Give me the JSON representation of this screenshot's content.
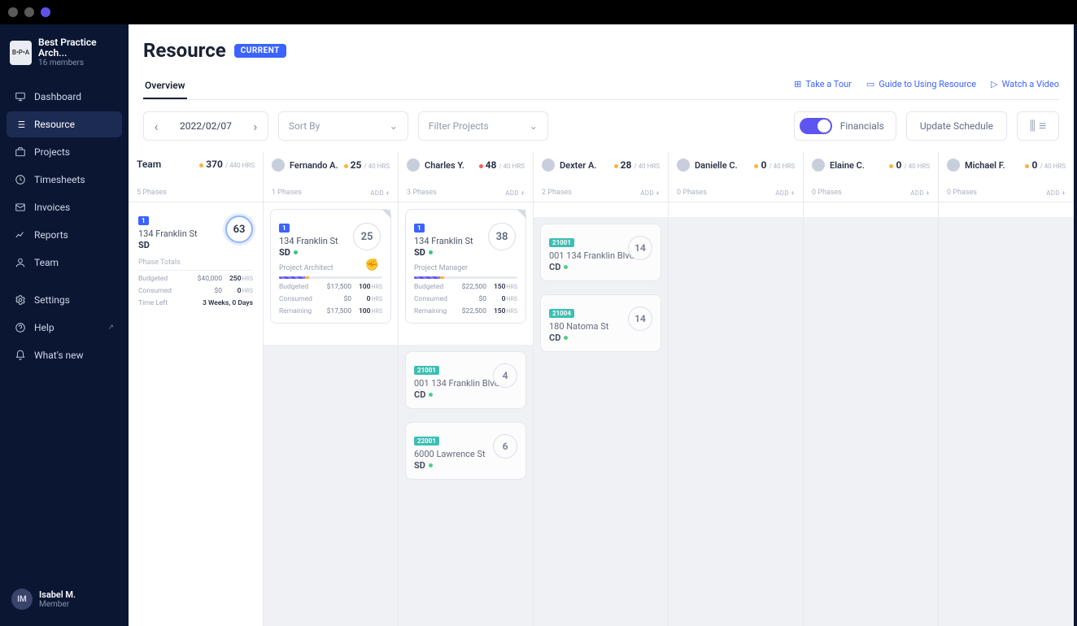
{
  "workspace": {
    "logo": "B•P•A",
    "name": "Best Practice Arch...",
    "members": "16 members"
  },
  "nav": {
    "dashboard": "Dashboard",
    "resource": "Resource",
    "projects": "Projects",
    "timesheets": "Timesheets",
    "invoices": "Invoices",
    "reports": "Reports",
    "team": "Team",
    "settings": "Settings",
    "help": "Help",
    "whatsnew": "What's new"
  },
  "user": {
    "initials": "IM",
    "name": "Isabel M.",
    "role": "Member"
  },
  "page": {
    "title": "Resource",
    "badge": "CURRENT",
    "tab_overview": "Overview",
    "help_tour": "Take a Tour",
    "help_guide": "Guide to Using Resource",
    "help_video": "Watch a Video"
  },
  "toolbar": {
    "date": "2022/02/07",
    "sort_by": "Sort By",
    "filter": "Filter Projects",
    "toggle_label": "Financials",
    "update": "Update Schedule"
  },
  "columns": [
    {
      "key": "team",
      "name": "Team",
      "hours": "370",
      "cap": "/ 440 HRS",
      "dot": "orange",
      "phases": "5 Phases",
      "add": ""
    },
    {
      "key": "fernando",
      "name": "Fernando A.",
      "hours": "25",
      "cap": "/ 40 HRS",
      "dot": "orange",
      "phases": "1 Phases",
      "add": "ADD +"
    },
    {
      "key": "charles",
      "name": "Charles Y.",
      "hours": "48",
      "cap": "/ 40 HRS",
      "dot": "red",
      "phases": "3 Phases",
      "add": "ADD +"
    },
    {
      "key": "dexter",
      "name": "Dexter A.",
      "hours": "28",
      "cap": "/ 40 HRS",
      "dot": "orange",
      "phases": "2 Phases",
      "add": "ADD +"
    },
    {
      "key": "danielle",
      "name": "Danielle C.",
      "hours": "0",
      "cap": "/ 40 HRS",
      "dot": "orange",
      "phases": "0 Phases",
      "add": "ADD +"
    },
    {
      "key": "elaine",
      "name": "Elaine C.",
      "hours": "0",
      "cap": "/ 40 HRS",
      "dot": "orange",
      "phases": "0 Phases",
      "add": "ADD +"
    },
    {
      "key": "michael",
      "name": "Michael F.",
      "hours": "0",
      "cap": "/ 40 HRS",
      "dot": "orange",
      "phases": "0 Phases",
      "add": "ADD +"
    }
  ],
  "team_card": {
    "pid": "1",
    "pname": "134 Franklin St",
    "phase": "SD",
    "num": "63",
    "phase_totals_label": "Phase Totals",
    "budgeted_l": "Budgeted",
    "budgeted_v": "$40,000",
    "budgeted_h": "250",
    "consumed_l": "Consumed",
    "consumed_v": "$0",
    "consumed_h": "0",
    "timeleft_l": "Time Left",
    "timeleft_v": "3 Weeks, 0 Days"
  },
  "fernando_card": {
    "pid": "1",
    "pname": "134 Franklin St",
    "phase": "SD",
    "num": "25",
    "role": "Project Architect",
    "budgeted_l": "Budgeted",
    "budgeted_v": "$17,500",
    "budgeted_h": "100",
    "consumed_l": "Consumed",
    "consumed_v": "$0",
    "consumed_h": "0",
    "remaining_l": "Remaining",
    "remaining_v": "$17,500",
    "remaining_h": "100"
  },
  "charles_card": {
    "pid": "1",
    "pname": "134 Franklin St",
    "phase": "SD",
    "num": "38",
    "role": "Project Manager",
    "budgeted_l": "Budgeted",
    "budgeted_v": "$22,500",
    "budgeted_h": "150",
    "consumed_l": "Consumed",
    "consumed_v": "$0",
    "consumed_h": "0",
    "remaining_l": "Remaining",
    "remaining_v": "$22,500",
    "remaining_h": "150"
  },
  "mini": {
    "c_21001": {
      "pid": "21001",
      "pname": "001 134 Franklin Blvd",
      "phase": "CD",
      "num": "4"
    },
    "c_22001": {
      "pid": "22001",
      "pname": "6000 Lawrence St",
      "phase": "SD",
      "num": "6"
    },
    "d_21001": {
      "pid": "21001",
      "pname": "001 134 Franklin Blvd",
      "phase": "CD",
      "num": "14"
    },
    "d_21004": {
      "pid": "21004",
      "pname": "180 Natoma St",
      "phase": "CD",
      "num": "14"
    }
  },
  "hrs_unit": "HRS"
}
